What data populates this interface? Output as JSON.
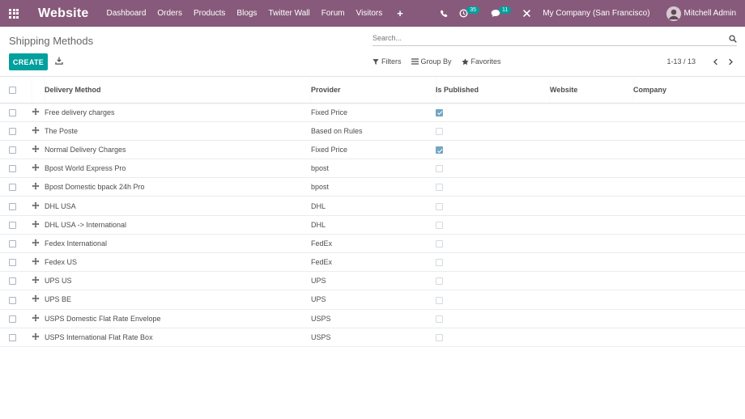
{
  "navbar": {
    "brand": "Website",
    "menu": [
      "Dashboard",
      "Orders",
      "Products",
      "Blogs",
      "Twitter Wall",
      "Forum",
      "Visitors"
    ],
    "plus": "+",
    "activity_count": "35",
    "messages_count": "11",
    "company": "My Company (San Francisco)",
    "user": "Mitchell Admin",
    "color": "#875a7b"
  },
  "control": {
    "title": "Shipping Methods",
    "search_placeholder": "Search...",
    "create_label": "CREATE",
    "filters_label": "Filters",
    "groupby_label": "Group By",
    "favorites_label": "Favorites",
    "pager_value": "1-13 / 13",
    "accent": "#00a09d"
  },
  "table": {
    "headers": {
      "name": "Delivery Method",
      "provider": "Provider",
      "published": "Is Published",
      "website": "Website",
      "company": "Company"
    },
    "rows": [
      {
        "name": "Free delivery charges",
        "provider": "Fixed Price",
        "published": true
      },
      {
        "name": "The Poste",
        "provider": "Based on Rules",
        "published": false
      },
      {
        "name": "Normal Delivery Charges",
        "provider": "Fixed Price",
        "published": true
      },
      {
        "name": "Bpost World Express Pro",
        "provider": "bpost",
        "published": false
      },
      {
        "name": "Bpost Domestic bpack 24h Pro",
        "provider": "bpost",
        "published": false
      },
      {
        "name": "DHL USA",
        "provider": "DHL",
        "published": false
      },
      {
        "name": "DHL USA -> International",
        "provider": "DHL",
        "published": false
      },
      {
        "name": "Fedex International",
        "provider": "FedEx",
        "published": false
      },
      {
        "name": "Fedex US",
        "provider": "FedEx",
        "published": false
      },
      {
        "name": "UPS US",
        "provider": "UPS",
        "published": false
      },
      {
        "name": "UPS BE",
        "provider": "UPS",
        "published": false
      },
      {
        "name": "USPS Domestic Flat Rate Envelope",
        "provider": "USPS",
        "published": false
      },
      {
        "name": "USPS International Flat Rate Box",
        "provider": "USPS",
        "published": false
      }
    ]
  }
}
